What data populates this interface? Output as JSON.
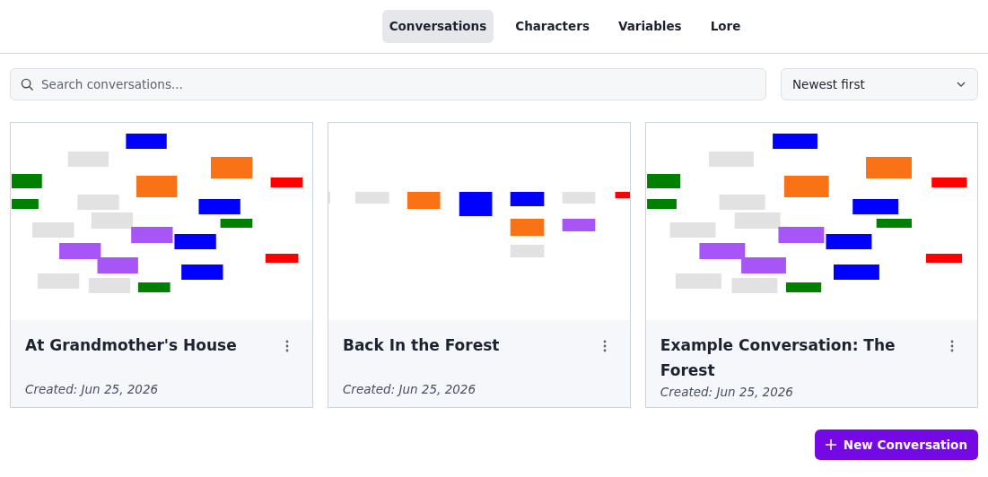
{
  "tabs": [
    {
      "label": "Conversations",
      "selected": true
    },
    {
      "label": "Characters",
      "selected": false
    },
    {
      "label": "Variables",
      "selected": false
    },
    {
      "label": "Lore",
      "selected": false
    }
  ],
  "search": {
    "placeholder": "Search conversations..."
  },
  "sort": {
    "value": "Newest first"
  },
  "conversations": [
    {
      "kind": "picture",
      "title": "At Grandmother's House",
      "created": "Created: Jun 25, 2026"
    },
    {
      "kind": "picture",
      "title": "Back In the Forest",
      "created": "Created: Jun 25, 2026"
    },
    {
      "kind": "picture",
      "title": "Example Conversation: The Forest",
      "created": "Created: Jun 25, 2026"
    }
  ],
  "new_button": {
    "label": "New Conversation"
  }
}
